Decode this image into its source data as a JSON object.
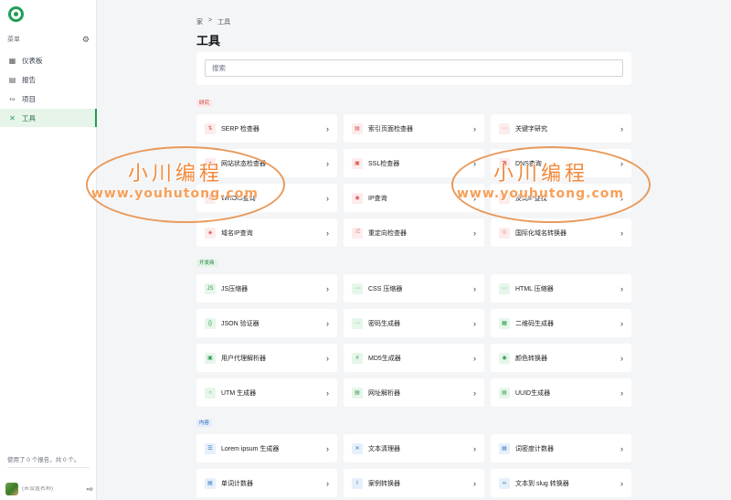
{
  "sidebar": {
    "menu_label": "菜单",
    "items": [
      {
        "label": "仪表板",
        "icon": "grid-icon"
      },
      {
        "label": "报告",
        "icon": "table-icon"
      },
      {
        "label": "项目",
        "icon": "nodes-icon"
      },
      {
        "label": "工具",
        "icon": "tools-icon",
        "active": true
      }
    ],
    "footer_text": "使用了 0 个报告，共 0 个。",
    "user_text": "(未设置名称)"
  },
  "breadcrumb": {
    "home": "家",
    "separator": ">",
    "current": "工具"
  },
  "page_title": "工具",
  "search": {
    "placeholder": "搜索"
  },
  "sections": [
    {
      "tag": "研究",
      "tools": [
        {
          "label": "SERP 检查器",
          "icon": "serp-icon"
        },
        {
          "label": "索引页面检查器",
          "icon": "index-icon"
        },
        {
          "label": "关键字研究",
          "icon": "keyword-icon"
        },
        {
          "label": "网站状态检查器",
          "icon": "status-icon"
        },
        {
          "label": "SSL检查器",
          "icon": "lock-icon"
        },
        {
          "label": "DNS查询",
          "icon": "dns-icon"
        },
        {
          "label": "WHOIS查询",
          "icon": "whois-icon"
        },
        {
          "label": "IP查询",
          "icon": "ip-icon"
        },
        {
          "label": "反向IP查找",
          "icon": "reverse-ip-icon"
        },
        {
          "label": "域名IP查询",
          "icon": "domain-ip-icon"
        },
        {
          "label": "重定向检查器",
          "icon": "redirect-icon"
        },
        {
          "label": "国际化域名转换器",
          "icon": "globe-icon"
        }
      ]
    },
    {
      "tag": "开发商",
      "tools": [
        {
          "label": "JS压缩器",
          "icon": "js-icon"
        },
        {
          "label": "CSS 压缩器",
          "icon": "css-icon"
        },
        {
          "label": "HTML 压缩器",
          "icon": "html-icon"
        },
        {
          "label": "JSON 验证器",
          "icon": "braces-icon"
        },
        {
          "label": "密码生成器",
          "icon": "password-icon"
        },
        {
          "label": "二维码生成器",
          "icon": "qr-icon"
        },
        {
          "label": "用户代理解析器",
          "icon": "browser-icon"
        },
        {
          "label": "MD5生成器",
          "icon": "hash-icon"
        },
        {
          "label": "颜色转换器",
          "icon": "palette-icon"
        },
        {
          "label": "UTM 生成器",
          "icon": "utm-icon"
        },
        {
          "label": "网址解析器",
          "icon": "url-icon"
        },
        {
          "label": "UUID生成器",
          "icon": "uuid-icon"
        }
      ]
    },
    {
      "tag": "内容",
      "tools": [
        {
          "label": "Lorem ipsum 生成器",
          "icon": "text-lines-icon"
        },
        {
          "label": "文本清理器",
          "icon": "text-clean-icon"
        },
        {
          "label": "词密度计数器",
          "icon": "density-icon"
        },
        {
          "label": "单词计数器",
          "icon": "counter-icon"
        },
        {
          "label": "案例转换器",
          "icon": "case-icon"
        },
        {
          "label": "文本到 slug 转换器",
          "icon": "link-icon"
        }
      ]
    }
  ],
  "watermark": {
    "title": "小川编程",
    "url": "www.youhutong.com"
  }
}
